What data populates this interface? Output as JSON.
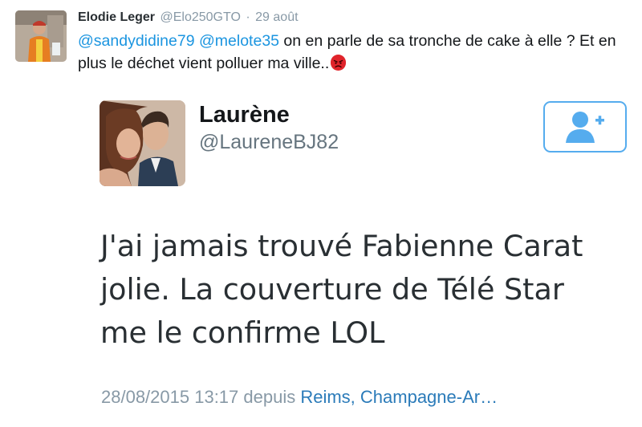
{
  "tweet": {
    "display_name": "Elodie Leger",
    "screen_name": "@Elo250GTO",
    "separator": "·",
    "timestamp": "29 août",
    "mention_1": "@sandydidine79",
    "mention_2": "@melote35",
    "text": " on en parle de sa tronche de cake à elle ? Et en plus le déchet vient polluer ma ville..",
    "emoji": "angry-face",
    "colors": {
      "link": "#1b95e0",
      "meta": "#8899a6",
      "text": "#14171a"
    }
  },
  "embedded_tweet": {
    "display_name": "Laurène",
    "screen_name": "@LaureneBJ82",
    "follow_icon": "add-user-icon",
    "body_lines": [
      "J'ai jamais trouvé Fabienne Carat",
      "jolie. La couverture de Télé Star",
      "me le confirme LOL"
    ],
    "date": "28/08/2015 13:17 depuis",
    "location": "Reims, Champagne-Ar…",
    "colors": {
      "accent": "#55acee",
      "location": "#2b7bb9"
    }
  }
}
